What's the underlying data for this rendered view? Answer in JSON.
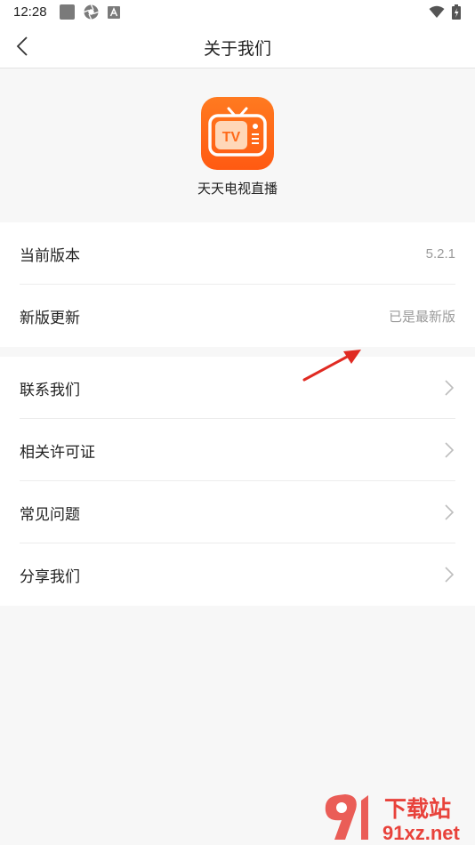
{
  "status_bar": {
    "time": "12:28",
    "left_icons": [
      "gallery-icon",
      "aperture-icon",
      "font-icon"
    ],
    "right_icons": [
      "wifi-icon",
      "battery-charging-icon"
    ]
  },
  "nav": {
    "title": "关于我们",
    "back_icon": "chevron-left-icon"
  },
  "app": {
    "name": "天天电视直播",
    "icon_text": "TV",
    "icon_color": "#ff6a1a"
  },
  "info_group": [
    {
      "label": "当前版本",
      "value": "5.2.1"
    },
    {
      "label": "新版更新",
      "value": "已是最新版"
    }
  ],
  "link_group": [
    {
      "label": "联系我们"
    },
    {
      "label": "相关许可证"
    },
    {
      "label": "常见问题"
    },
    {
      "label": "分享我们"
    }
  ],
  "watermark": {
    "logo_text": "下载站",
    "url_text": "91xz.net",
    "accent_color": "#e8423b"
  },
  "colors": {
    "background": "#f7f7f7",
    "card": "#ffffff",
    "secondary_text": "#9b9b9b",
    "annotation_arrow": "#e02a22"
  }
}
